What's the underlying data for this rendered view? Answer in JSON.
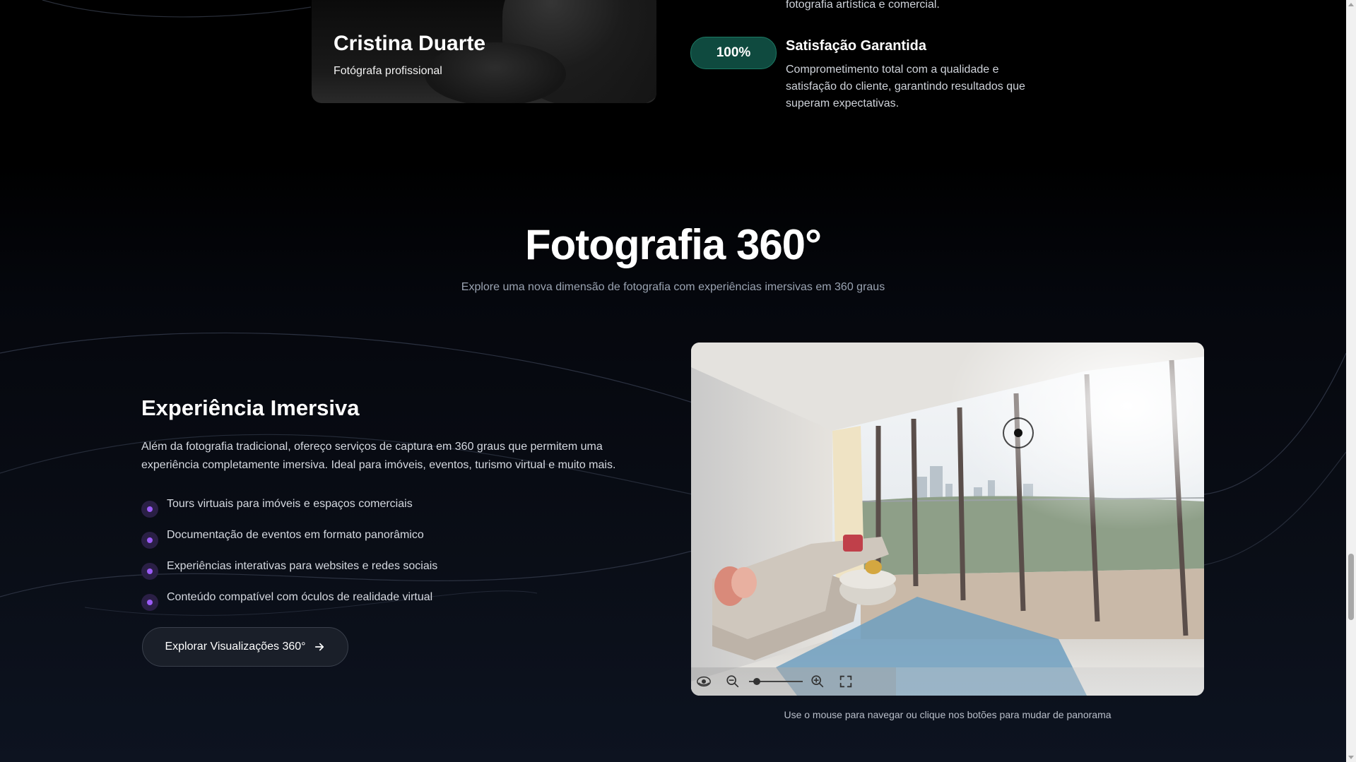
{
  "profile": {
    "name": "Cristina Duarte",
    "role": "Fotógrafa profissional"
  },
  "previous_feature": {
    "text": "fotografia artística e comercial."
  },
  "feature": {
    "badge": "100%",
    "title": "Satisfação Garantida",
    "description": "Comprometimento total com a qualidade e satisfação do cliente, garantindo resultados que superam expectativas."
  },
  "section": {
    "title": "Fotografia 360°",
    "subtitle": "Explore uma nova dimensão de fotografia com experiências imersivas em 360 graus"
  },
  "immersive": {
    "title": "Experiência Imersiva",
    "description": "Além da fotografia tradicional, ofereço serviços de captura em 360 graus que permitem uma experiência completamente imersiva. Ideal para imóveis, eventos, turismo virtual e muito mais.",
    "items": [
      "Tours virtuais para imóveis e espaços comerciais",
      "Documentação de eventos em formato panorâmico",
      "Experiências interativas para websites e redes sociais",
      "Conteúdo compatível com óculos de realidade virtual"
    ],
    "button_label": "Explorar Visualizações 360°"
  },
  "viewer": {
    "caption": "Use o mouse para navegar ou clique nos botões para mudar de panorama",
    "zoom_level": 0.1,
    "icons": [
      "rotate-360-icon",
      "zoom-out-icon",
      "zoom-in-icon",
      "fullscreen-icon",
      "arrow-right-icon"
    ]
  },
  "colors": {
    "accent_purple": "#9b5cf6",
    "badge_green": "#0f4a3f",
    "background": "#000000"
  }
}
